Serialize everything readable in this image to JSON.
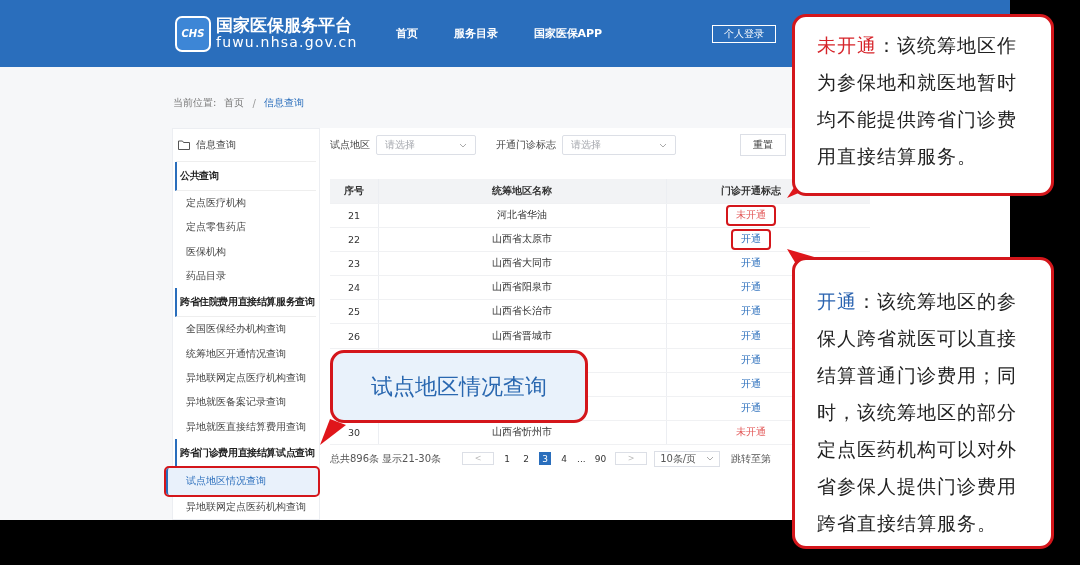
{
  "header": {
    "logo_mark": "CHS",
    "title": "国家医保服务平台",
    "subtitle": "fuwu.nhsa.gov.cn",
    "nav": [
      "首页",
      "服务目录",
      "国家医保APP"
    ],
    "login_button": "个人登录"
  },
  "breadcrumb": {
    "label": "当前位置:",
    "separator": "/",
    "items": [
      {
        "text": "首页",
        "selected": false
      },
      {
        "text": "信息查询",
        "selected": true
      }
    ]
  },
  "sidebar": {
    "root": "信息查询",
    "groups": [
      {
        "title": "公共查询",
        "items": [
          {
            "label": "定点医疗机构",
            "selected": false,
            "annotated": false
          },
          {
            "label": "定点零售药店",
            "selected": false,
            "annotated": false
          },
          {
            "label": "医保机构",
            "selected": false,
            "annotated": false
          },
          {
            "label": "药品目录",
            "selected": false,
            "annotated": false
          }
        ]
      },
      {
        "title": "跨省住院费用直接结算服务查询",
        "items": [
          {
            "label": "全国医保经办机构查询",
            "selected": false,
            "annotated": false
          },
          {
            "label": "统筹地区开通情况查询",
            "selected": false,
            "annotated": false
          },
          {
            "label": "异地联网定点医疗机构查询",
            "selected": false,
            "annotated": false
          },
          {
            "label": "异地就医备案记录查询",
            "selected": false,
            "annotated": false
          },
          {
            "label": "异地就医直接结算费用查询",
            "selected": false,
            "annotated": false
          }
        ]
      },
      {
        "title": "跨省门诊费用直接结算试点查询",
        "items": [
          {
            "label": "试点地区情况查询",
            "selected": true,
            "annotated": true
          },
          {
            "label": "异地联网定点医药机构查询",
            "selected": false,
            "annotated": false
          }
        ]
      }
    ]
  },
  "filters": [
    {
      "label": "试点地区",
      "placeholder": "请选择"
    },
    {
      "label": "开通门诊标志",
      "placeholder": "请选择"
    }
  ],
  "reset_button": "重置",
  "table": {
    "columns": [
      "序号",
      "统筹地区名称",
      "门诊开通标志"
    ],
    "rows": [
      {
        "seq": "21",
        "name": "河北省华油",
        "status": "未开通",
        "kind": "closed",
        "annotated": true
      },
      {
        "seq": "22",
        "name": "山西省太原市",
        "status": "开通",
        "kind": "open",
        "annotated": true
      },
      {
        "seq": "23",
        "name": "山西省大同市",
        "status": "开通",
        "kind": "open",
        "annotated": false
      },
      {
        "seq": "24",
        "name": "山西省阳泉市",
        "status": "开通",
        "kind": "open",
        "annotated": false
      },
      {
        "seq": "25",
        "name": "山西省长治市",
        "status": "开通",
        "kind": "open",
        "annotated": false
      },
      {
        "seq": "26",
        "name": "山西省晋城市",
        "status": "开通",
        "kind": "open",
        "annotated": false
      },
      {
        "status": "开通",
        "kind": "open",
        "annotated": false
      },
      {
        "status": "开通",
        "kind": "open",
        "annotated": false
      },
      {
        "status": "开通",
        "kind": "open",
        "annotated": false
      },
      {
        "seq": "30",
        "name": "山西省忻州市",
        "status": "未开通",
        "kind": "closed",
        "annotated": false
      }
    ]
  },
  "pagination": {
    "total": "总共896条",
    "range": "显示21-30条",
    "prev": "<",
    "pages": [
      {
        "label": "1",
        "selected": false
      },
      {
        "label": "2",
        "selected": false
      },
      {
        "label": "3",
        "selected": true
      },
      {
        "label": "4",
        "selected": false
      }
    ],
    "ellipsis": "...",
    "last_page": {
      "label": "90",
      "selected": false
    },
    "next": ">",
    "per_page": "10条/页",
    "jump_label": "跳转至第"
  },
  "callouts": [
    {
      "term": "未开通",
      "kind": "closed",
      "text": "：该统筹地区作为参保地和就医地暂时均不能提供跨省门诊费用直接结算服务。"
    },
    {
      "term": "开通",
      "kind": "open",
      "text": "：该统筹地区的参保人跨省就医可以直接结算普通门诊费用；同时，该统筹地区的部分定点医药机构可以对外省参保人提供门诊费用跨省直接结算服务。"
    }
  ],
  "page_callout": "试点地区情况查询"
}
